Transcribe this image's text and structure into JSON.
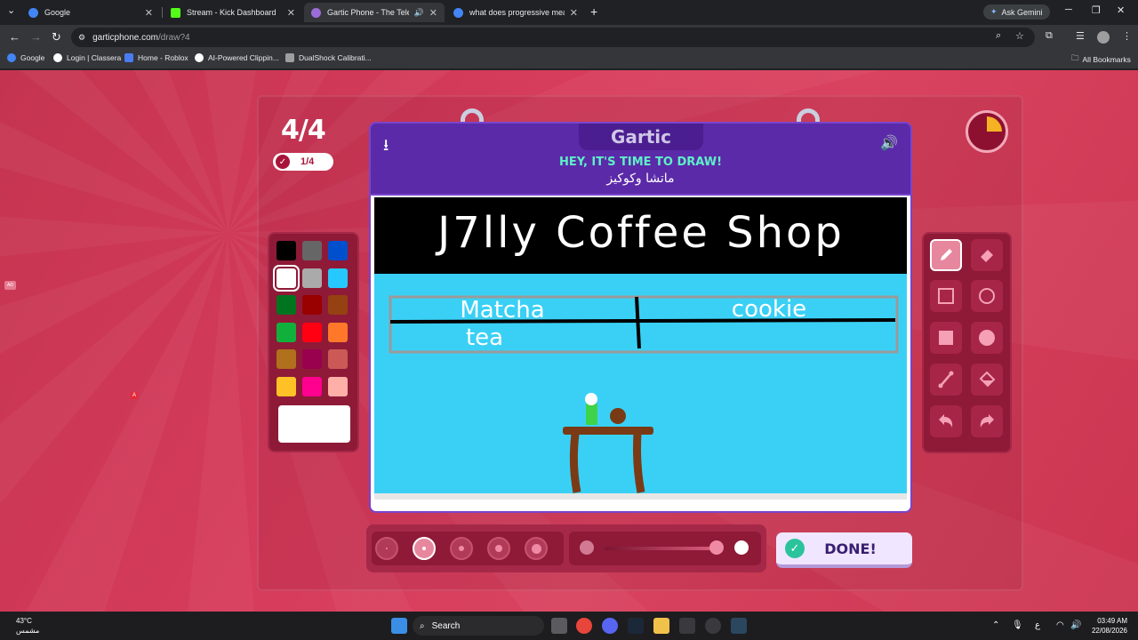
{
  "browser": {
    "tabs": [
      {
        "title": "Google",
        "favicon_color": "#4285f4",
        "active": false
      },
      {
        "title": "Stream - Kick Dashboard",
        "favicon_color": "#53fc18",
        "active": false
      },
      {
        "title": "Gartic Phone - The Telepho",
        "favicon_color": "#9c6cd8",
        "active": true
      },
      {
        "title": "what does progressive mean -",
        "favicon_color": "#4285f4",
        "active": false
      }
    ],
    "new_tab": "+",
    "gemini_label": "Ask Gemini",
    "url_host": "garticphone.com",
    "url_path": "/draw?4",
    "bookmarks": [
      {
        "label": "Google",
        "color": "#4285f4"
      },
      {
        "label": "Login | Classera",
        "color": "#ffffff"
      },
      {
        "label": "Home - Roblox",
        "color": "#4a7cf0"
      },
      {
        "label": "AI-Powered Clippin...",
        "color": "#ffffff"
      },
      {
        "label": "DualShock Calibrati...",
        "color": "#9e9e9e"
      }
    ],
    "all_bookmarks": "All Bookmarks"
  },
  "game": {
    "round": "4/4",
    "done_count": "1/4",
    "logo": "Gartic",
    "prompt_heading": "HEY, IT'S TIME TO DRAW!",
    "prompt_word": "ماتشا وكوكيز",
    "done_label": "DONE!",
    "timer_fraction_elapsed": 0.25,
    "selected_color": "#ffffff",
    "selected_tool": "pencil",
    "selected_brush_size_index": 1,
    "palette": [
      "#000000",
      "#666666",
      "#0050cd",
      "#ffffff",
      "#aaaaaa",
      "#26c9ff",
      "#017420",
      "#990000",
      "#964112",
      "#11b03c",
      "#ff0013",
      "#ff7829",
      "#b0701c",
      "#99004e",
      "#cb5a57",
      "#ffc126",
      "#ff008f",
      "#feafa8"
    ],
    "tools": [
      "pencil",
      "eraser",
      "rectangle",
      "ellipse",
      "filled-rectangle",
      "filled-ellipse",
      "line",
      "fill-bucket",
      "undo",
      "redo"
    ],
    "drawing_texts": [
      "J7lly Coffee Shop",
      "Matcha",
      "tea",
      "cookie"
    ]
  },
  "taskbar": {
    "weather_temp": "43°C",
    "weather_desc": "مشمس",
    "search_label": "Search",
    "time": "03:49 AM",
    "date": "22/08/2026",
    "lang": "ع"
  }
}
